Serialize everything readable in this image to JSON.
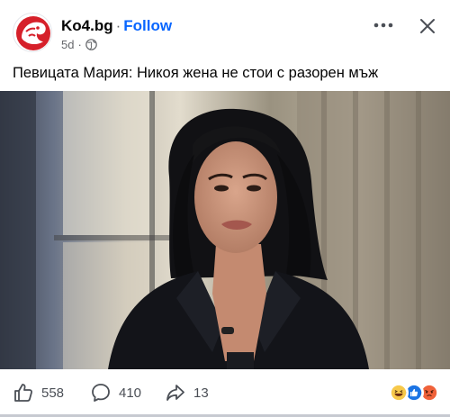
{
  "post": {
    "page_name": "Ko4.bg",
    "separator": "·",
    "follow_label": "Follow",
    "time": "5d",
    "time_separator": "·",
    "caption": "Певицата Мария: Никоя жена не стои с разорен мъж"
  },
  "header_icons": {
    "more": "more-horizontal-icon",
    "close": "close-icon",
    "audience": "globe-icon"
  },
  "actions": {
    "like_count": "558",
    "comment_count": "410",
    "share_count": "13"
  },
  "reactions": [
    "haha",
    "like",
    "angry"
  ],
  "colors": {
    "link_blue": "#0866ff",
    "secondary_text": "#65676b",
    "brand_red": "#d6202a"
  }
}
